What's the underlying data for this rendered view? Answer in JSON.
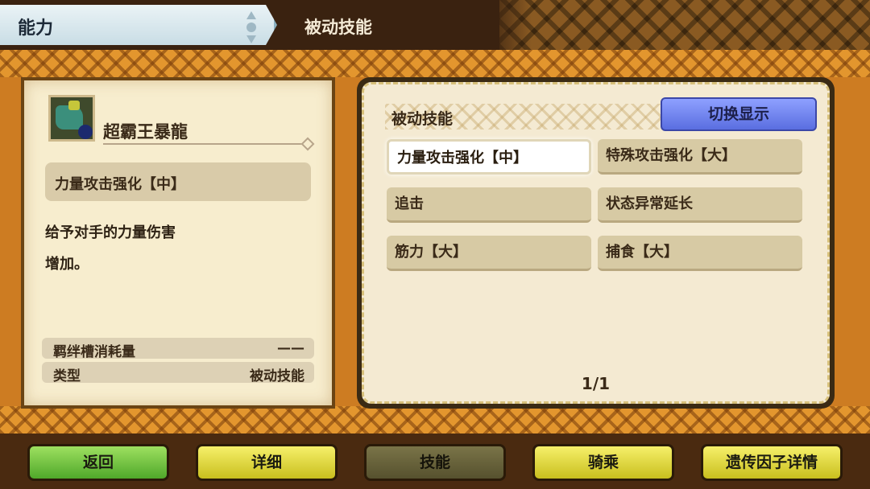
{
  "header": {
    "tab_label": "能力",
    "title": "被动技能"
  },
  "monster": {
    "name": "超霸王暴龍",
    "selected_skill": "力量攻击强化【中】",
    "description_lines": [
      "给予对手的力量伤害",
      "增加。"
    ],
    "info": [
      {
        "label": "羁绊槽消耗量",
        "value": "——"
      },
      {
        "label": "类型",
        "value": "被动技能"
      }
    ]
  },
  "skills_panel": {
    "title": "被动技能",
    "switch_label": "切换显示",
    "skills": [
      {
        "label": "力量攻击强化【中】",
        "selected": true
      },
      {
        "label": "特殊攻击强化【大】",
        "selected": false
      },
      {
        "label": "追击",
        "selected": false
      },
      {
        "label": "状态异常延长",
        "selected": false
      },
      {
        "label": "筋力【大】",
        "selected": false
      },
      {
        "label": "捕食【大】",
        "selected": false
      }
    ],
    "page": "1/1"
  },
  "bottom_buttons": [
    {
      "label": "返回",
      "style": "green"
    },
    {
      "label": "详细",
      "style": "yellow"
    },
    {
      "label": "技能",
      "style": "dark"
    },
    {
      "label": "骑乘",
      "style": "yellow"
    },
    {
      "label": "遗传因子详情",
      "style": "yellow"
    }
  ],
  "colors": {
    "accent_blue": "#6f82f0",
    "green_button": "#6cc23a",
    "yellow_button": "#e4da3a"
  }
}
